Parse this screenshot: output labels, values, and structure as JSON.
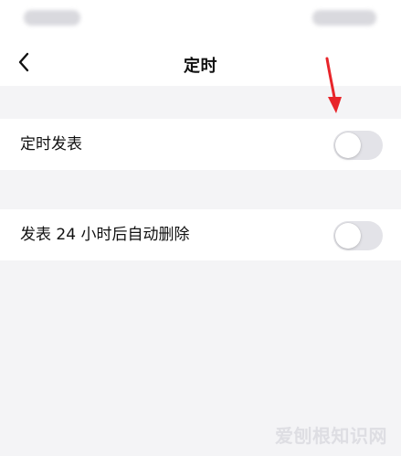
{
  "nav": {
    "title": "定时",
    "back_icon": "chevron-left-icon"
  },
  "settings": [
    {
      "label": "定时发表",
      "enabled": false
    },
    {
      "label": "发表 24 小时后自动删除",
      "enabled": false
    }
  ],
  "watermark": "爱刨根知识网",
  "colors": {
    "background": "#f4f4f6",
    "row_background": "#ffffff",
    "toggle_off": "#e3e3e8",
    "annotation_arrow": "#e8252a"
  }
}
